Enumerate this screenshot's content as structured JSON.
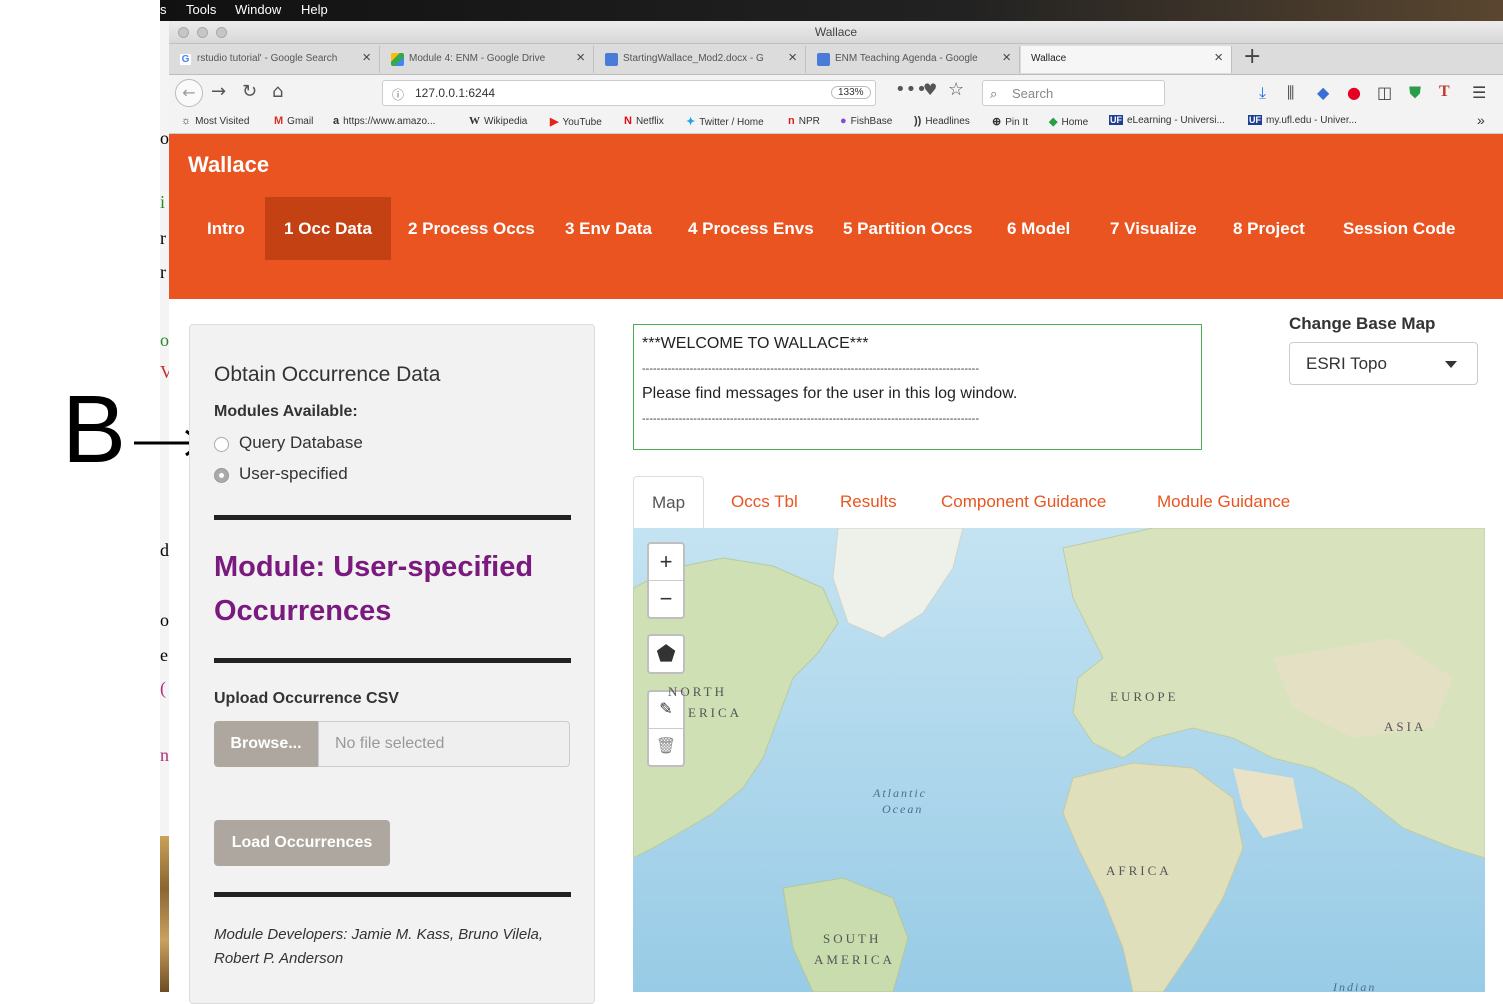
{
  "annotation": {
    "letter": "B"
  },
  "left_fragments": [
    "o",
    "i",
    "r",
    "r",
    "o",
    "V",
    "d",
    "o",
    "e",
    "(",
    "n"
  ],
  "menubar": {
    "items": [
      "s",
      "Tools",
      "Window",
      "Help"
    ]
  },
  "window": {
    "title": "Wallace"
  },
  "browser_tabs": [
    {
      "label": "rstudio tutorial' - Google Search",
      "icon_color": "#4285f4",
      "active": false
    },
    {
      "label": "Module 4: ENM - Google Drive",
      "icon_color": "#34a853",
      "active": false
    },
    {
      "label": "StartingWallace_Mod2.docx - G",
      "icon_color": "#4a7bd9",
      "active": false
    },
    {
      "label": "ENM Teaching Agenda - Google",
      "icon_color": "#4a7bd9",
      "active": false
    },
    {
      "label": "Wallace",
      "icon_color": "",
      "active": true
    }
  ],
  "navbar": {
    "url": "127.0.0.1:6244",
    "zoom": "133%",
    "search_placeholder": "Search"
  },
  "bookmarks": [
    {
      "label": "Most Visited",
      "glyph": "☼"
    },
    {
      "label": "Gmail",
      "glyph": "M"
    },
    {
      "label": "https://www.amazo...",
      "glyph": "a"
    },
    {
      "label": "Wikipedia",
      "glyph": "W"
    },
    {
      "label": "YouTube",
      "glyph": "▶"
    },
    {
      "label": "Netflix",
      "glyph": "N"
    },
    {
      "label": "Twitter / Home",
      "glyph": "✦"
    },
    {
      "label": "NPR",
      "glyph": "n"
    },
    {
      "label": "FishBase",
      "glyph": "●"
    },
    {
      "label": "Headlines",
      "glyph": "))"
    },
    {
      "label": "Pin It",
      "glyph": "⊕"
    },
    {
      "label": "Home",
      "glyph": "◆"
    },
    {
      "label": "eLearning - Universi...",
      "glyph": "UF"
    },
    {
      "label": "my.ufl.edu - Univer...",
      "glyph": "UF"
    }
  ],
  "app": {
    "brand": "Wallace",
    "nav": [
      "Intro",
      "1 Occ Data",
      "2 Process Occs",
      "3 Env Data",
      "4 Process Envs",
      "5 Partition Occs",
      "6 Model",
      "7 Visualize",
      "8 Project",
      "Session Code"
    ],
    "active_nav": "1 Occ Data"
  },
  "sidebar": {
    "title": "Obtain Occurrence Data",
    "modules_label": "Modules Available:",
    "options": [
      {
        "label": "Query Database",
        "checked": false
      },
      {
        "label": "User-specified",
        "checked": true
      }
    ],
    "module_title": "Module: User-specified Occurrences",
    "upload_label": "Upload Occurrence CSV",
    "browse_label": "Browse...",
    "file_placeholder": "No file selected",
    "load_label": "Load Occurrences",
    "developers": "Module Developers: Jamie M. Kass, Bruno Vilela, Robert P. Anderson"
  },
  "log": {
    "welcome": "***WELCOME TO WALLACE***",
    "message": "Please find messages for the user in this log window.",
    "separator": "--------------------------------------------------------------------------------------------"
  },
  "basemap": {
    "label": "Change Base Map",
    "selected": "ESRI Topo"
  },
  "map_tabs": [
    "Map",
    "Occs Tbl",
    "Results",
    "Component Guidance",
    "Module Guidance"
  ],
  "map": {
    "zoom_in": "+",
    "zoom_out": "−",
    "labels": {
      "north_america_1": "NORTH",
      "north_america_2": "ERICA",
      "europe": "EUROPE",
      "asia": "ASIA",
      "africa": "AFRICA",
      "south_america_1": "SOUTH",
      "south_america_2": "AMERICA",
      "atlantic_1": "Atlantic",
      "atlantic_2": "Ocean",
      "indian": "Indian"
    }
  }
}
